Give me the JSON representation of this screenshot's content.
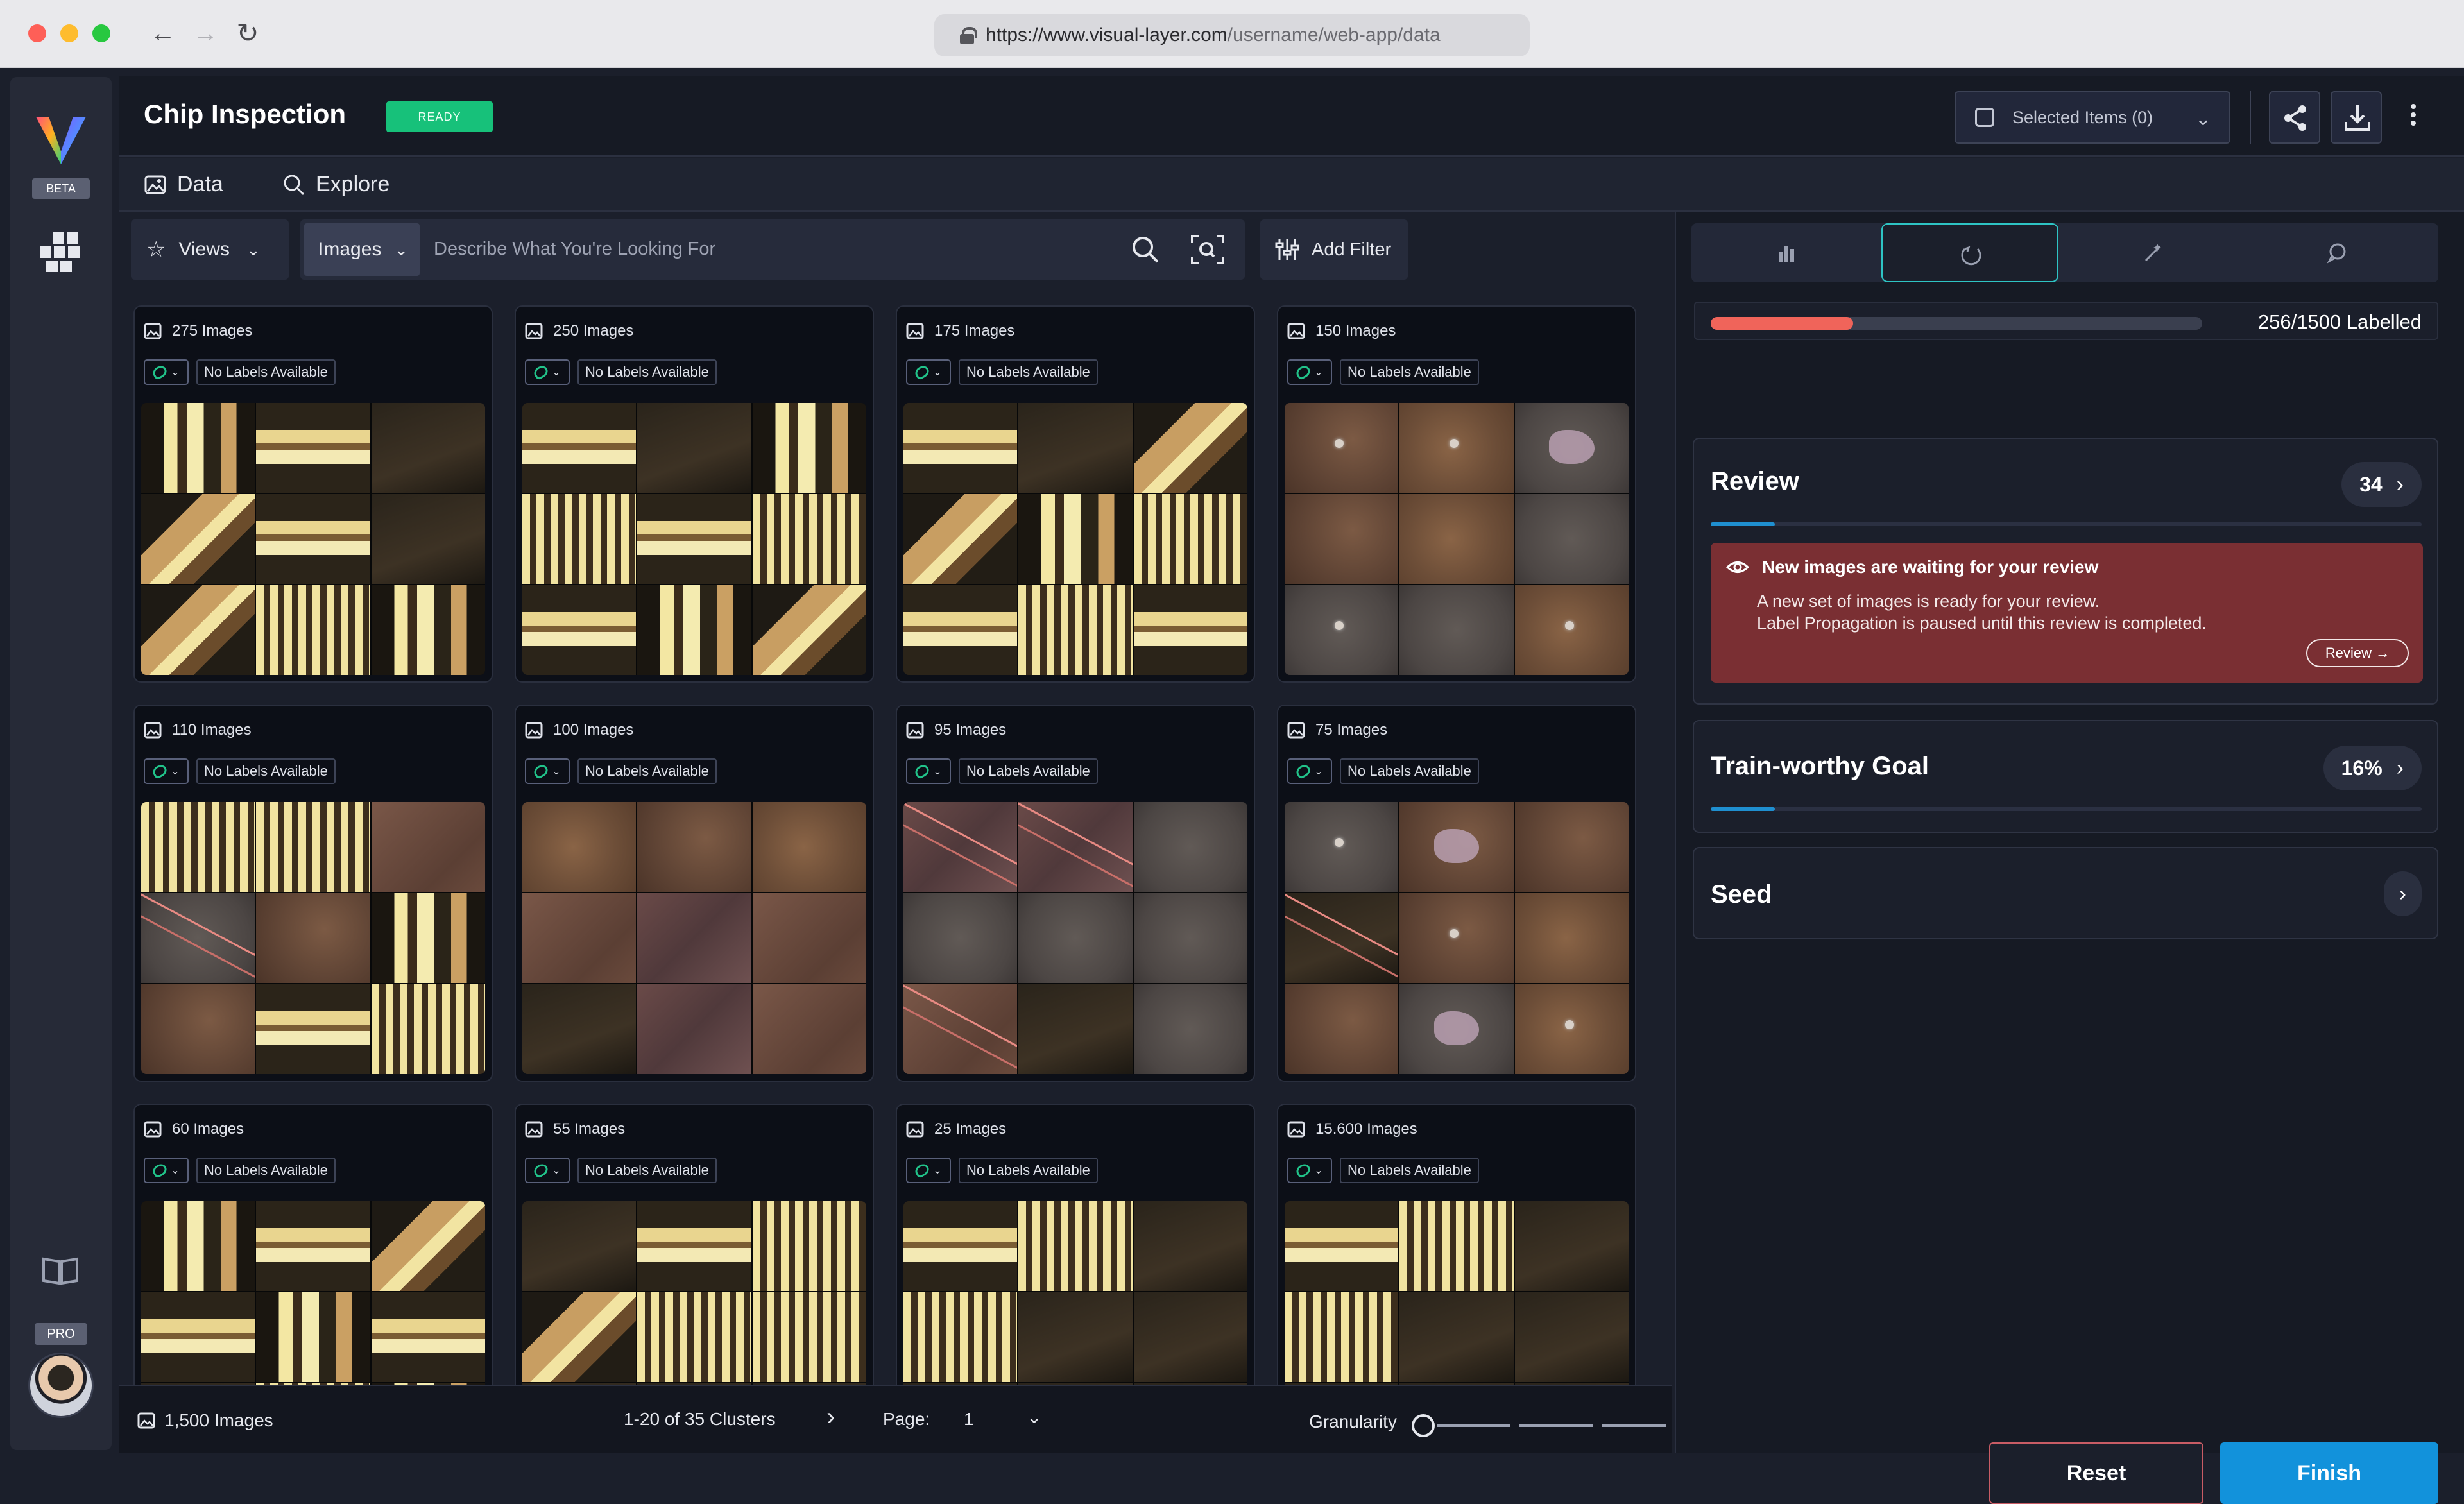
{
  "browser": {
    "url_main": "https://www.visual-layer.com",
    "url_rest": "/username/web-app/data"
  },
  "rail": {
    "beta": "BETA",
    "pro": "PRO"
  },
  "header": {
    "title": "Chip Inspection",
    "status": "READY",
    "selected_items": "Selected Items (0)"
  },
  "tabs": [
    {
      "label": "Data"
    },
    {
      "label": "Explore"
    }
  ],
  "toolbar": {
    "views": "Views",
    "type_select": "Images",
    "search_placeholder": "Describe What You're Looking For",
    "add_filter": "Add Filter"
  },
  "clusters": [
    {
      "count": "275 Images",
      "label": "No Labels Available"
    },
    {
      "count": "250 Images",
      "label": "No Labels Available"
    },
    {
      "count": "175 Images",
      "label": "No Labels Available"
    },
    {
      "count": "150 Images",
      "label": "No Labels Available"
    },
    {
      "count": "110 Images",
      "label": "No Labels Available"
    },
    {
      "count": "100 Images",
      "label": "No Labels Available"
    },
    {
      "count": "95 Images",
      "label": "No Labels Available"
    },
    {
      "count": "75 Images",
      "label": "No Labels Available"
    },
    {
      "count": "60 Images",
      "label": "No Labels Available"
    },
    {
      "count": "55 Images",
      "label": "No Labels Available"
    },
    {
      "count": "25 Images",
      "label": "No Labels Available"
    },
    {
      "count": "15.600 Images",
      "label": "No Labels Available"
    }
  ],
  "footer": {
    "total": "1,500 Images",
    "range": "1-20 of 35 Clusters",
    "page_label": "Page:",
    "page_value": "1",
    "granularity": "Granularity"
  },
  "panel": {
    "progress_text": "256/1500 Labelled",
    "progress_fraction": 0.29,
    "review": {
      "title": "Review",
      "count": "34",
      "progress_fraction": 0.09,
      "alert_title": "New images are waiting for your review",
      "alert_line1": "A new set of images is ready for your review.",
      "alert_line2": "Label Propagation is paused until this review is completed.",
      "alert_button": "Review →"
    },
    "goal": {
      "title": "Train-worthy Goal",
      "value": "16%",
      "progress_fraction": 0.09
    },
    "seed": {
      "title": "Seed"
    },
    "reset": "Reset",
    "finish": "Finish"
  }
}
